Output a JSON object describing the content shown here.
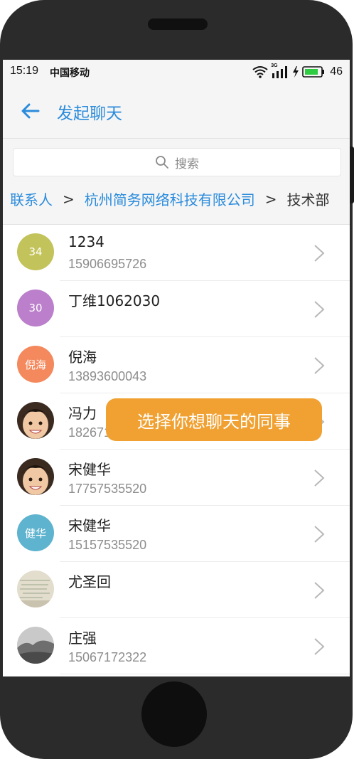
{
  "status_bar": {
    "time": "15:19",
    "carrier": "中国移动",
    "network_type": "3G",
    "battery": "46"
  },
  "header": {
    "title": "发起聊天"
  },
  "search": {
    "placeholder": "搜索"
  },
  "breadcrumb": {
    "items": [
      "联系人",
      "杭州简务网络科技有限公司",
      "技术部"
    ],
    "separator": ">"
  },
  "contacts": [
    {
      "name": "1234",
      "phone": "15906695726",
      "avatar_text": "34",
      "avatar_color": "#c3c35b"
    },
    {
      "name": "丁维1062030",
      "phone": "",
      "avatar_text": "30",
      "avatar_color": "#bb7fcb"
    },
    {
      "name": "倪海",
      "phone": "13893600043",
      "avatar_text": "倪海",
      "avatar_color": "#f4895e"
    },
    {
      "name": "冯力",
      "phone": "18267189972",
      "avatar_text": "",
      "avatar_color": "#5a3a28"
    },
    {
      "name": "宋健华",
      "phone": "17757535520",
      "avatar_text": "",
      "avatar_color": "#5a3a28"
    },
    {
      "name": "宋健华",
      "phone": "15157535520",
      "avatar_text": "健华",
      "avatar_color": "#5eb3cf"
    },
    {
      "name": "尤圣回",
      "phone": "",
      "avatar_text": "",
      "avatar_color": "#d8d3c2"
    },
    {
      "name": "庄强",
      "phone": "15067172322",
      "avatar_text": "",
      "avatar_color": "#8a8a8a"
    }
  ],
  "toast": {
    "text": "选择你想聊天的同事"
  },
  "colors": {
    "accent": "#2b8cdc",
    "toast": "#f0a132",
    "background": "#f5f5f5"
  }
}
